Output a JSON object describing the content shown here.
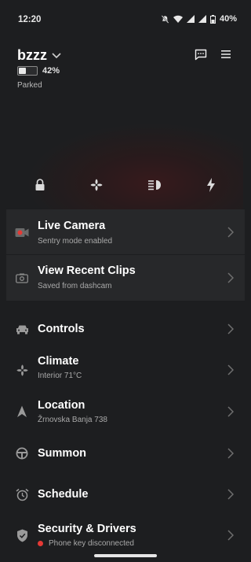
{
  "status_bar": {
    "time": "12:20",
    "battery_percent": "40%"
  },
  "vehicle": {
    "name": "bzzz",
    "battery_label": "42%",
    "battery_level": 0.42,
    "state": "Parked"
  },
  "quick_actions": [
    {
      "icon": "lock-icon"
    },
    {
      "icon": "fan-icon"
    },
    {
      "icon": "headlights-icon"
    },
    {
      "icon": "charge-icon"
    }
  ],
  "camera_card": {
    "live": {
      "title": "Live Camera",
      "subtitle": "Sentry mode enabled"
    },
    "clips": {
      "title": "View Recent Clips",
      "subtitle": "Saved from dashcam"
    }
  },
  "menu": {
    "controls": {
      "title": "Controls"
    },
    "climate": {
      "title": "Climate",
      "subtitle": "Interior 71°C"
    },
    "location": {
      "title": "Location",
      "subtitle": "Žrnovska Banja 738"
    },
    "summon": {
      "title": "Summon"
    },
    "schedule": {
      "title": "Schedule"
    },
    "security": {
      "title": "Security & Drivers",
      "subtitle": "Phone key disconnected"
    }
  },
  "colors": {
    "background": "#1d1e20",
    "card": "#27282a",
    "record_red": "#e53935"
  }
}
